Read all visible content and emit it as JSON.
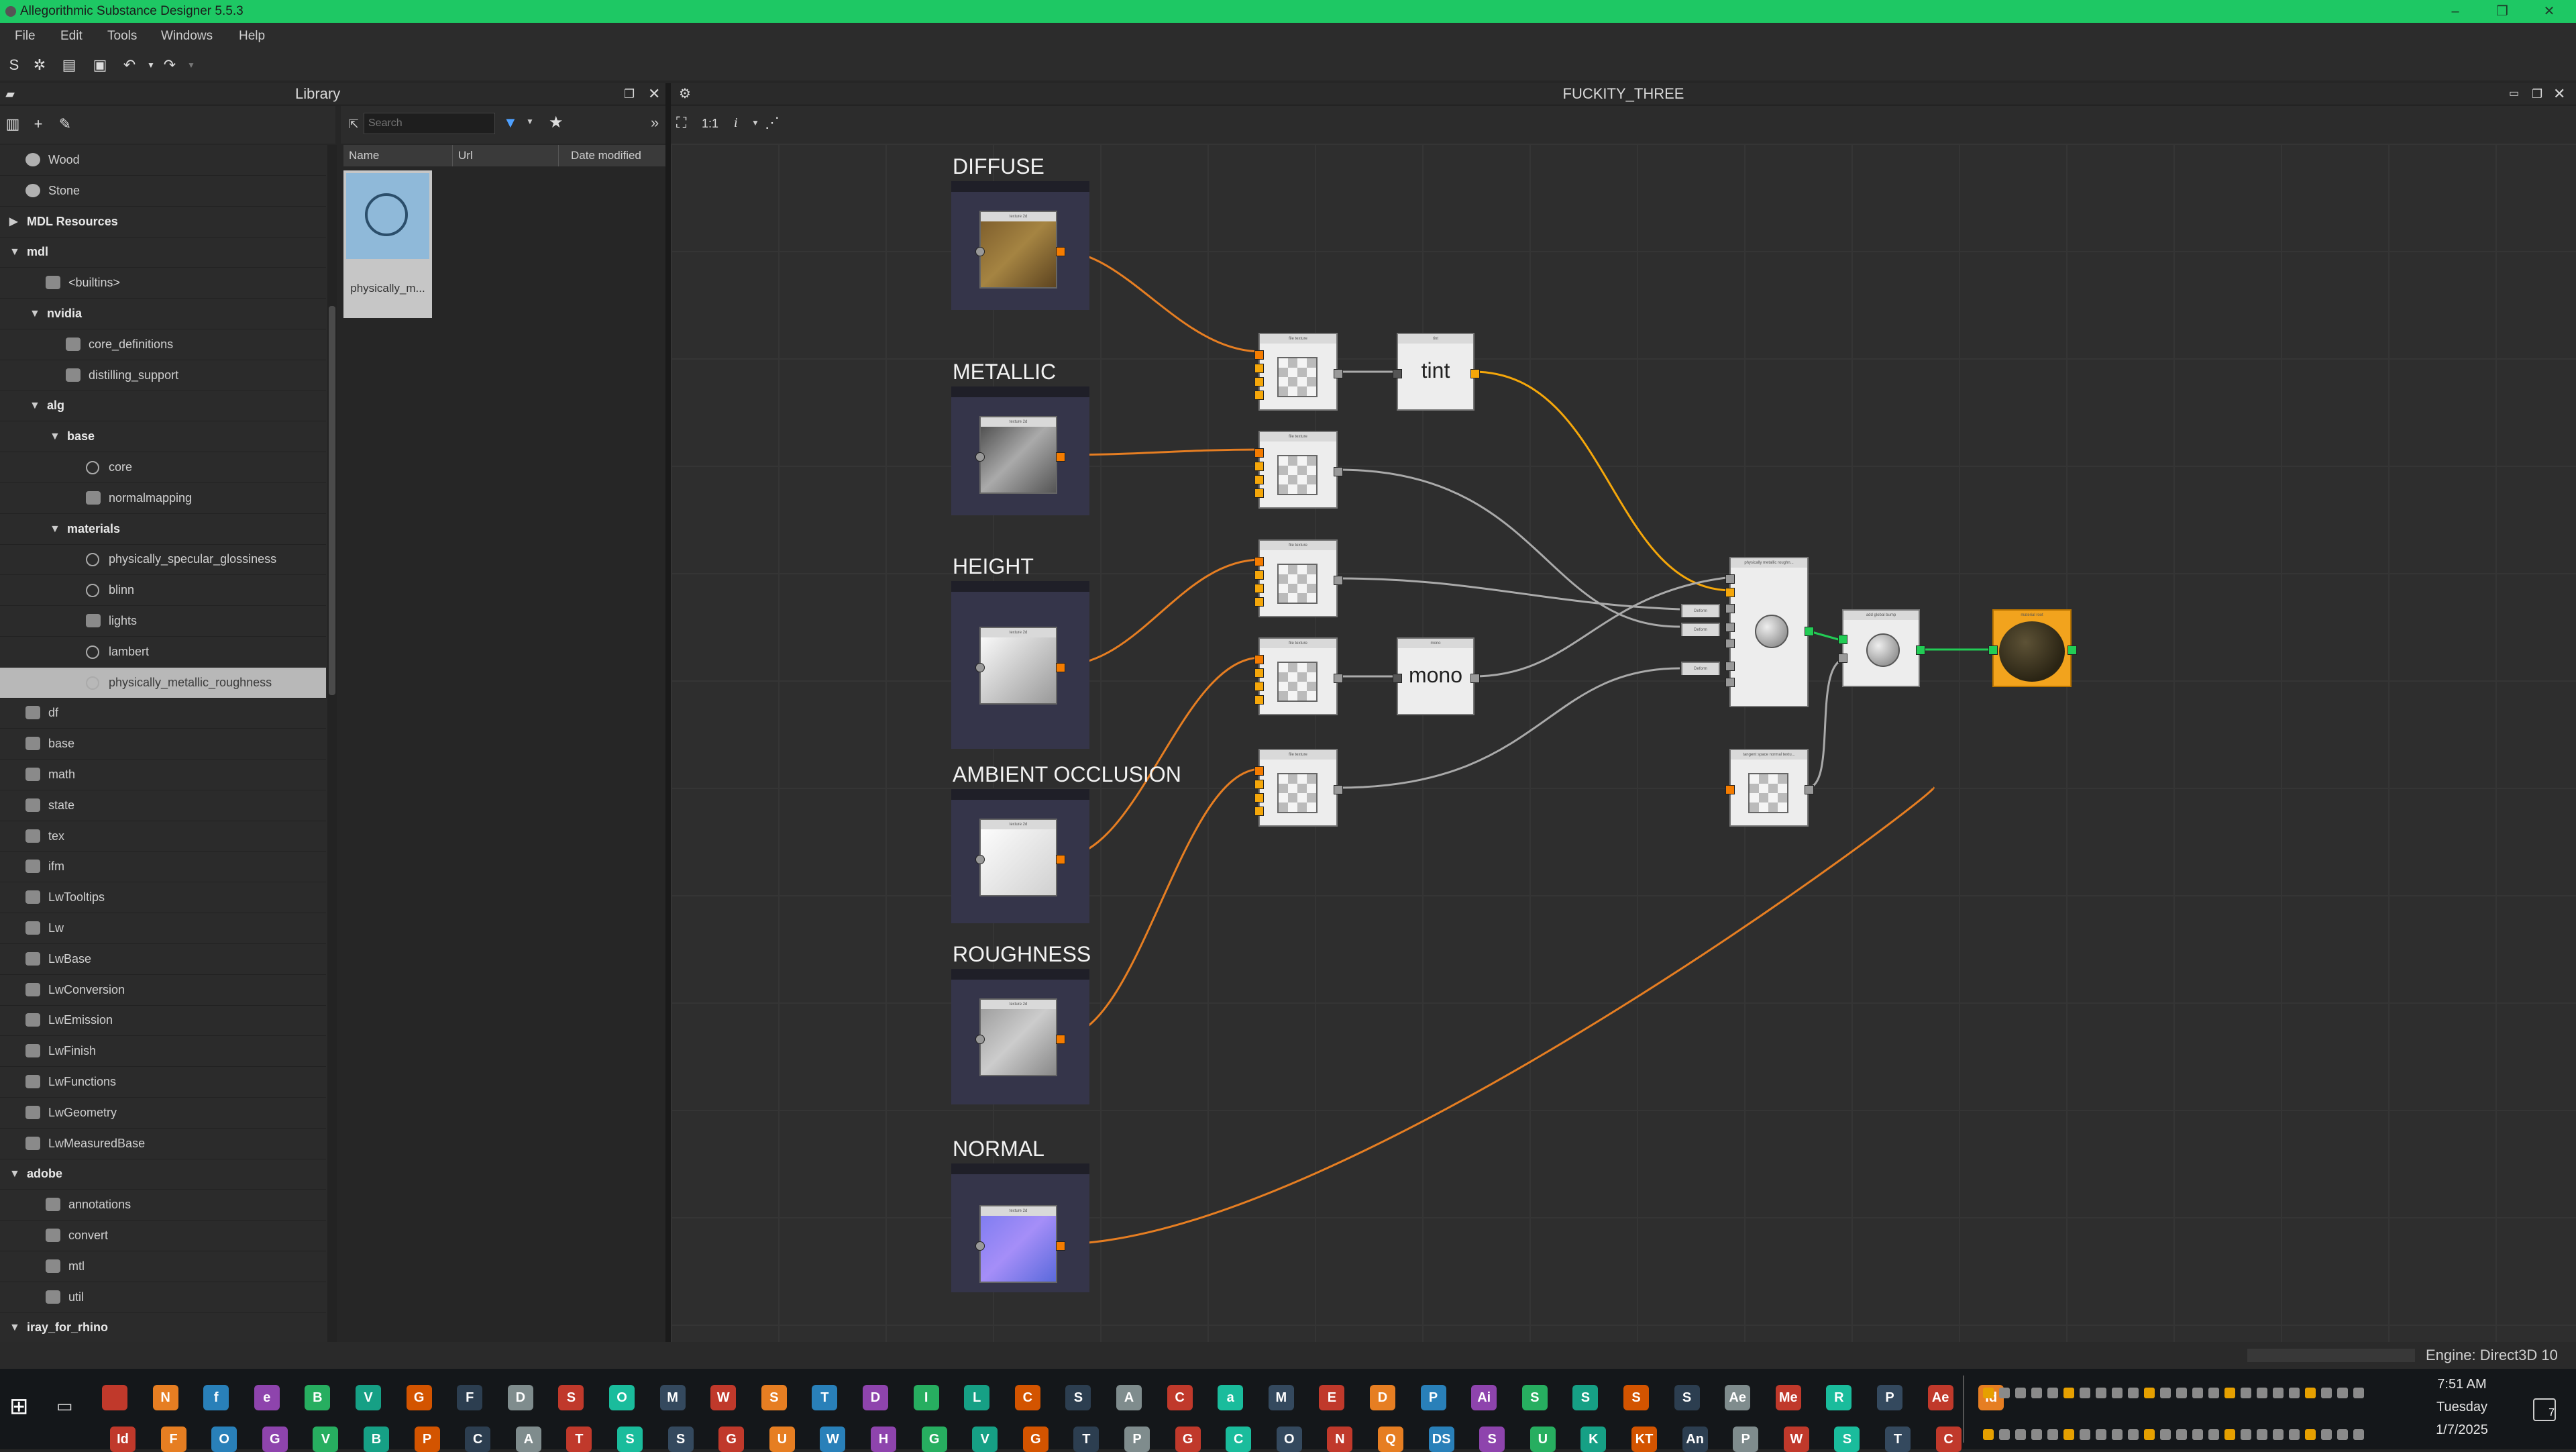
{
  "titlebar": {
    "title": "Allegorithmic Substance Designer 5.5.3"
  },
  "menu": [
    "File",
    "Edit",
    "Tools",
    "Windows",
    "Help"
  ],
  "library": {
    "title": "Library",
    "tree": [
      {
        "label": "Wood",
        "depth": 0,
        "icon": "sphere"
      },
      {
        "label": "Stone",
        "depth": 0,
        "icon": "sphere"
      },
      {
        "label": "MDL Resources",
        "depth": 0,
        "bold": true,
        "expander": "▶"
      },
      {
        "label": "mdl",
        "depth": 0,
        "bold": true,
        "expander": "▼"
      },
      {
        "label": "<builtins>",
        "depth": 1,
        "icon": "package"
      },
      {
        "label": "nvidia",
        "depth": 1,
        "bold": true,
        "expander": "▼"
      },
      {
        "label": "core_definitions",
        "depth": 2,
        "icon": "package"
      },
      {
        "label": "distilling_support",
        "depth": 2,
        "icon": "package"
      },
      {
        "label": "alg",
        "depth": 1,
        "bold": true,
        "expander": "▼"
      },
      {
        "label": "base",
        "depth": 2,
        "bold": true,
        "expander": "▼"
      },
      {
        "label": "core",
        "depth": 3,
        "icon": "material"
      },
      {
        "label": "normalmapping",
        "depth": 3,
        "icon": "package"
      },
      {
        "label": "materials",
        "depth": 2,
        "bold": true,
        "expander": "▼"
      },
      {
        "label": "physically_specular_glossiness",
        "depth": 3,
        "icon": "material"
      },
      {
        "label": "blinn",
        "depth": 3,
        "icon": "material"
      },
      {
        "label": "lights",
        "depth": 3,
        "icon": "light"
      },
      {
        "label": "lambert",
        "depth": 3,
        "icon": "material"
      },
      {
        "label": "physically_metallic_roughness",
        "depth": 3,
        "icon": "material",
        "selected": true
      },
      {
        "label": "df",
        "depth": 0,
        "icon": "curve"
      },
      {
        "label": "base",
        "depth": 0,
        "icon": "package"
      },
      {
        "label": "math",
        "depth": 0,
        "icon": "curve"
      },
      {
        "label": "state",
        "depth": 0,
        "icon": "axes"
      },
      {
        "label": "tex",
        "depth": 0,
        "icon": "checker"
      },
      {
        "label": "ifm",
        "depth": 0,
        "icon": "package"
      },
      {
        "label": "LwTooltips",
        "depth": 0,
        "icon": "package"
      },
      {
        "label": "Lw",
        "depth": 0,
        "icon": "package"
      },
      {
        "label": "LwBase",
        "depth": 0,
        "icon": "package"
      },
      {
        "label": "LwConversion",
        "depth": 0,
        "icon": "package"
      },
      {
        "label": "LwEmission",
        "depth": 0,
        "icon": "package"
      },
      {
        "label": "LwFinish",
        "depth": 0,
        "icon": "package"
      },
      {
        "label": "LwFunctions",
        "depth": 0,
        "icon": "package"
      },
      {
        "label": "LwGeometry",
        "depth": 0,
        "icon": "package"
      },
      {
        "label": "LwMeasuredBase",
        "depth": 0,
        "icon": "package"
      },
      {
        "label": "adobe",
        "depth": 0,
        "bold": true,
        "expander": "▼"
      },
      {
        "label": "annotations",
        "depth": 1,
        "icon": "package"
      },
      {
        "label": "convert",
        "depth": 1,
        "icon": "package"
      },
      {
        "label": "mtl",
        "depth": 1,
        "icon": "package"
      },
      {
        "label": "util",
        "depth": 1,
        "icon": "package"
      },
      {
        "label": "iray_for_rhino",
        "depth": 0,
        "bold": true,
        "expander": "▼"
      }
    ],
    "search_placeholder": "Search",
    "columns": [
      "Name",
      "Url",
      "Date modified"
    ],
    "thumb_label": "physically_m..."
  },
  "graph": {
    "title": "FUCKITY_THREE",
    "zoom_label": "1:1",
    "info_label": "i",
    "frames": [
      "DIFFUSE",
      "METALLIC",
      "HEIGHT",
      "AMBIENT OCCLUSION",
      "ROUGHNESS",
      "NORMAL"
    ],
    "node_texture2d": "texture 2d",
    "node_filetexture": "file texture",
    "node_tint_header": "tint",
    "node_tint": "tint",
    "node_mono_header": "mono",
    "node_mono": "mono",
    "node_pmr": "physically metallic roughn...",
    "node_tangent": "tangent space normal textu...",
    "node_fixed": "add global bump",
    "node_output": "material root",
    "node_small": "Deform"
  },
  "status": {
    "engine": "Engine: Direct3D 10"
  },
  "clock": {
    "time": "7:51 AM",
    "day": "Tuesday",
    "date": "1/7/2025",
    "notifications": "7"
  },
  "taskbar_top": [
    "",
    "N",
    "f",
    "e",
    "B",
    "V",
    "G",
    "F",
    "D",
    "S",
    "O",
    "M",
    "W",
    "S",
    "T",
    "D",
    "I",
    "L",
    "C",
    "S",
    "A",
    "C",
    "a",
    "M",
    "E",
    "D",
    "P",
    "Ai",
    "S",
    "S",
    "S",
    "S",
    "Ae",
    "Me",
    "R",
    "P",
    "Ae",
    "Id"
  ],
  "taskbar_bottom": [
    "Id",
    "F",
    "O",
    "G",
    "V",
    "B",
    "P",
    "C",
    "A",
    "T",
    "S",
    "S",
    "G",
    "U",
    "W",
    "H",
    "G",
    "V",
    "G",
    "T",
    "P",
    "G",
    "C",
    "O",
    "N",
    "Q",
    "DS",
    "S",
    "U",
    "K",
    "KT",
    "An",
    "P",
    "W",
    "S",
    "T",
    "C"
  ]
}
